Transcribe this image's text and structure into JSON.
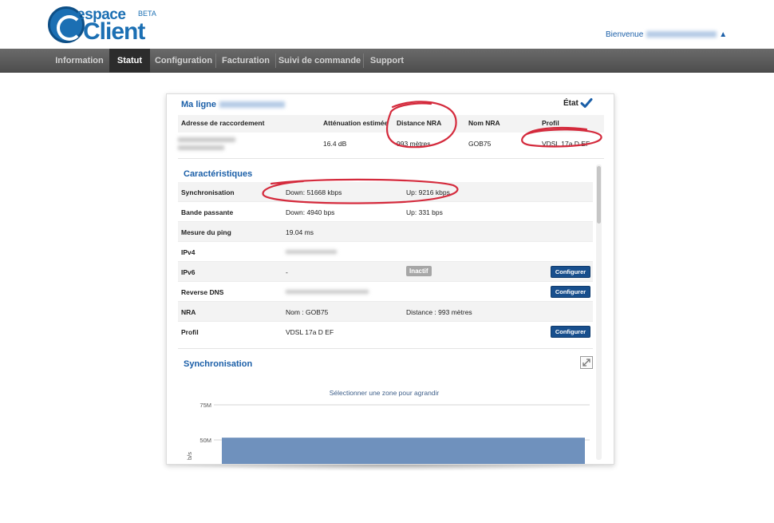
{
  "header": {
    "logo_espace": "espace",
    "logo_client": "Client",
    "logo_beta": "BETA",
    "welcome": "Bienvenue",
    "welcome_arrow": "▲"
  },
  "nav": {
    "items": [
      {
        "label": "Information"
      },
      {
        "label": "Statut"
      },
      {
        "label": "Configuration"
      },
      {
        "label": "Facturation"
      },
      {
        "label": "Suivi de commande"
      },
      {
        "label": "Support"
      }
    ],
    "active": "Statut"
  },
  "line": {
    "title": "Ma ligne",
    "etat_label": "État",
    "columns": {
      "adresse": "Adresse de raccordement",
      "attenuation": "Atténuation estimée",
      "distance": "Distance NRA",
      "nom": "Nom NRA",
      "profil": "Profil"
    },
    "values": {
      "attenuation": "16.4 dB",
      "distance": "993 mètres",
      "nom": "GOB75",
      "profil": "VDSL 17a D EF"
    }
  },
  "characteristics": {
    "title": "Caractéristiques",
    "rows": [
      {
        "label": "Synchronisation",
        "v1": "Down: 51668 kbps",
        "v2": "Up: 9216 kbps"
      },
      {
        "label": "Bande passante",
        "v1": "Down: 4940 bps",
        "v2": "Up: 331 bps"
      },
      {
        "label": "Mesure du ping",
        "v1": "19.04 ms",
        "v2": ""
      },
      {
        "label": "IPv4",
        "v1": "",
        "v2": ""
      },
      {
        "label": "IPv6",
        "v1": "-",
        "v2": ""
      },
      {
        "label": "Reverse DNS",
        "v1": "",
        "v2": ""
      },
      {
        "label": "NRA",
        "v1": "Nom : GOB75",
        "v2": "Distance : 993 mètres"
      },
      {
        "label": "Profil",
        "v1": "VDSL 17a D EF",
        "v2": ""
      }
    ],
    "badge_inactif": "Inactif",
    "configure_label": "Configurer"
  },
  "sync_chart": {
    "title": "Synchronisation",
    "hint": "Sélectionner une zone pour agrandir",
    "ylabel": "b/s"
  },
  "chart_data": {
    "type": "area",
    "title": "Synchronisation",
    "ylabel": "b/s",
    "yticks": [
      "75M",
      "50M"
    ],
    "series": [
      {
        "values": [
          51668000,
          51668000
        ]
      }
    ],
    "color": "#6f91bd"
  },
  "colors": {
    "accent": "#1b5fa8",
    "button": "#184f8d",
    "annotation": "#d42a3c"
  }
}
